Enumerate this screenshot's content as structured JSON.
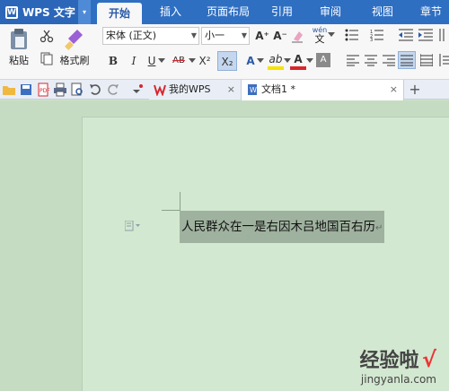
{
  "app": {
    "title": "WPS 文字",
    "logo": "W",
    "menu_arrow": "▾"
  },
  "ribbon_tabs": [
    "开始",
    "插入",
    "页面布局",
    "引用",
    "审阅",
    "视图",
    "章节"
  ],
  "toolbar": {
    "paste_label": "粘贴",
    "format_painter_label": "格式刷",
    "font_name": "宋体 (正文)",
    "font_size": "小一",
    "grow_font": "A⁺",
    "shrink_font": "A⁻",
    "phonetic_top": "wén",
    "phonetic_bottom": "文",
    "bold": "B",
    "italic": "I",
    "underline": "U",
    "strikethrough": "AB",
    "superscript": "X²",
    "subscript": "X₂",
    "text_effect": "A",
    "highlight": "ab",
    "font_color": "A",
    "char_shading": "A"
  },
  "doc_tabs": [
    {
      "label": "我的WPS",
      "close": "×"
    },
    {
      "label": "文档1 *",
      "close": "×"
    }
  ],
  "new_tab": "+",
  "document": {
    "selected_text": "人民群众在一是右因木吕地国百右历",
    "para_symbol": "↵"
  },
  "watermark": {
    "title": "经验啦",
    "check": "√",
    "url": "jingyanla.com"
  },
  "colors": {
    "ribbon_blue": "#2f6fc2",
    "page_green": "#d3e8d0",
    "selection": "#9fb29f",
    "wps_red": "#d8262d"
  }
}
